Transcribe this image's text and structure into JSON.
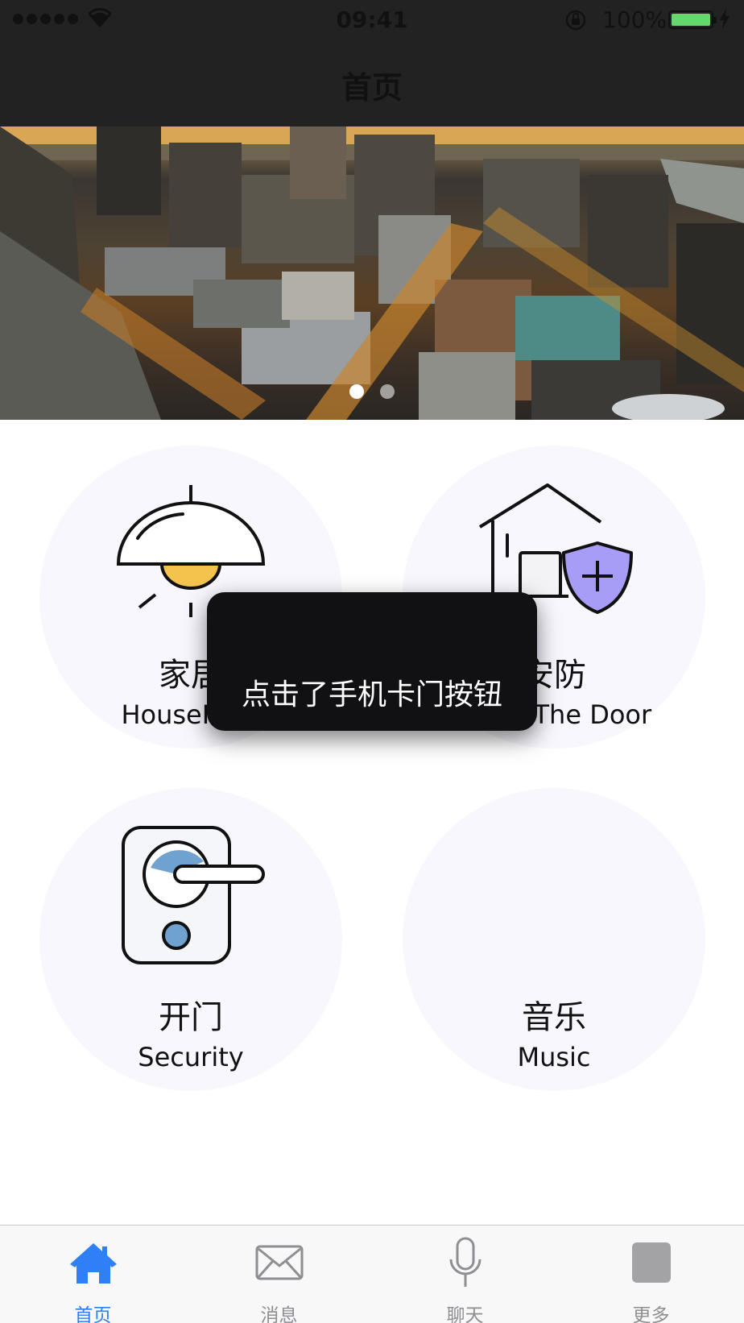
{
  "status_bar": {
    "time": "09:41",
    "battery": "100%"
  },
  "nav": {
    "title": "首页"
  },
  "banner": {
    "pages": 2,
    "current_page": 1
  },
  "tiles": [
    {
      "zh": "家居",
      "en": "HouseHold",
      "icon": "ceiling-lamp-icon"
    },
    {
      "zh": "安防",
      "en": "Open The Door",
      "icon": "house-shield-icon"
    },
    {
      "zh": "开门",
      "en": "Security",
      "icon": "door-handle-icon"
    },
    {
      "zh": "音乐",
      "en": "Music",
      "icon": ""
    }
  ],
  "toast": {
    "message": "点击了手机卡门按钮"
  },
  "tabbar": {
    "active_color": "#2f80f6",
    "inactive_color": "#8e8e93",
    "tabs": [
      {
        "label": "首页",
        "icon": "home-icon",
        "active": true
      },
      {
        "label": "消息",
        "icon": "envelope-icon",
        "active": false
      },
      {
        "label": "聊天",
        "icon": "microphone-icon",
        "active": false
      },
      {
        "label": "更多",
        "icon": "square-icon",
        "active": false
      }
    ]
  }
}
